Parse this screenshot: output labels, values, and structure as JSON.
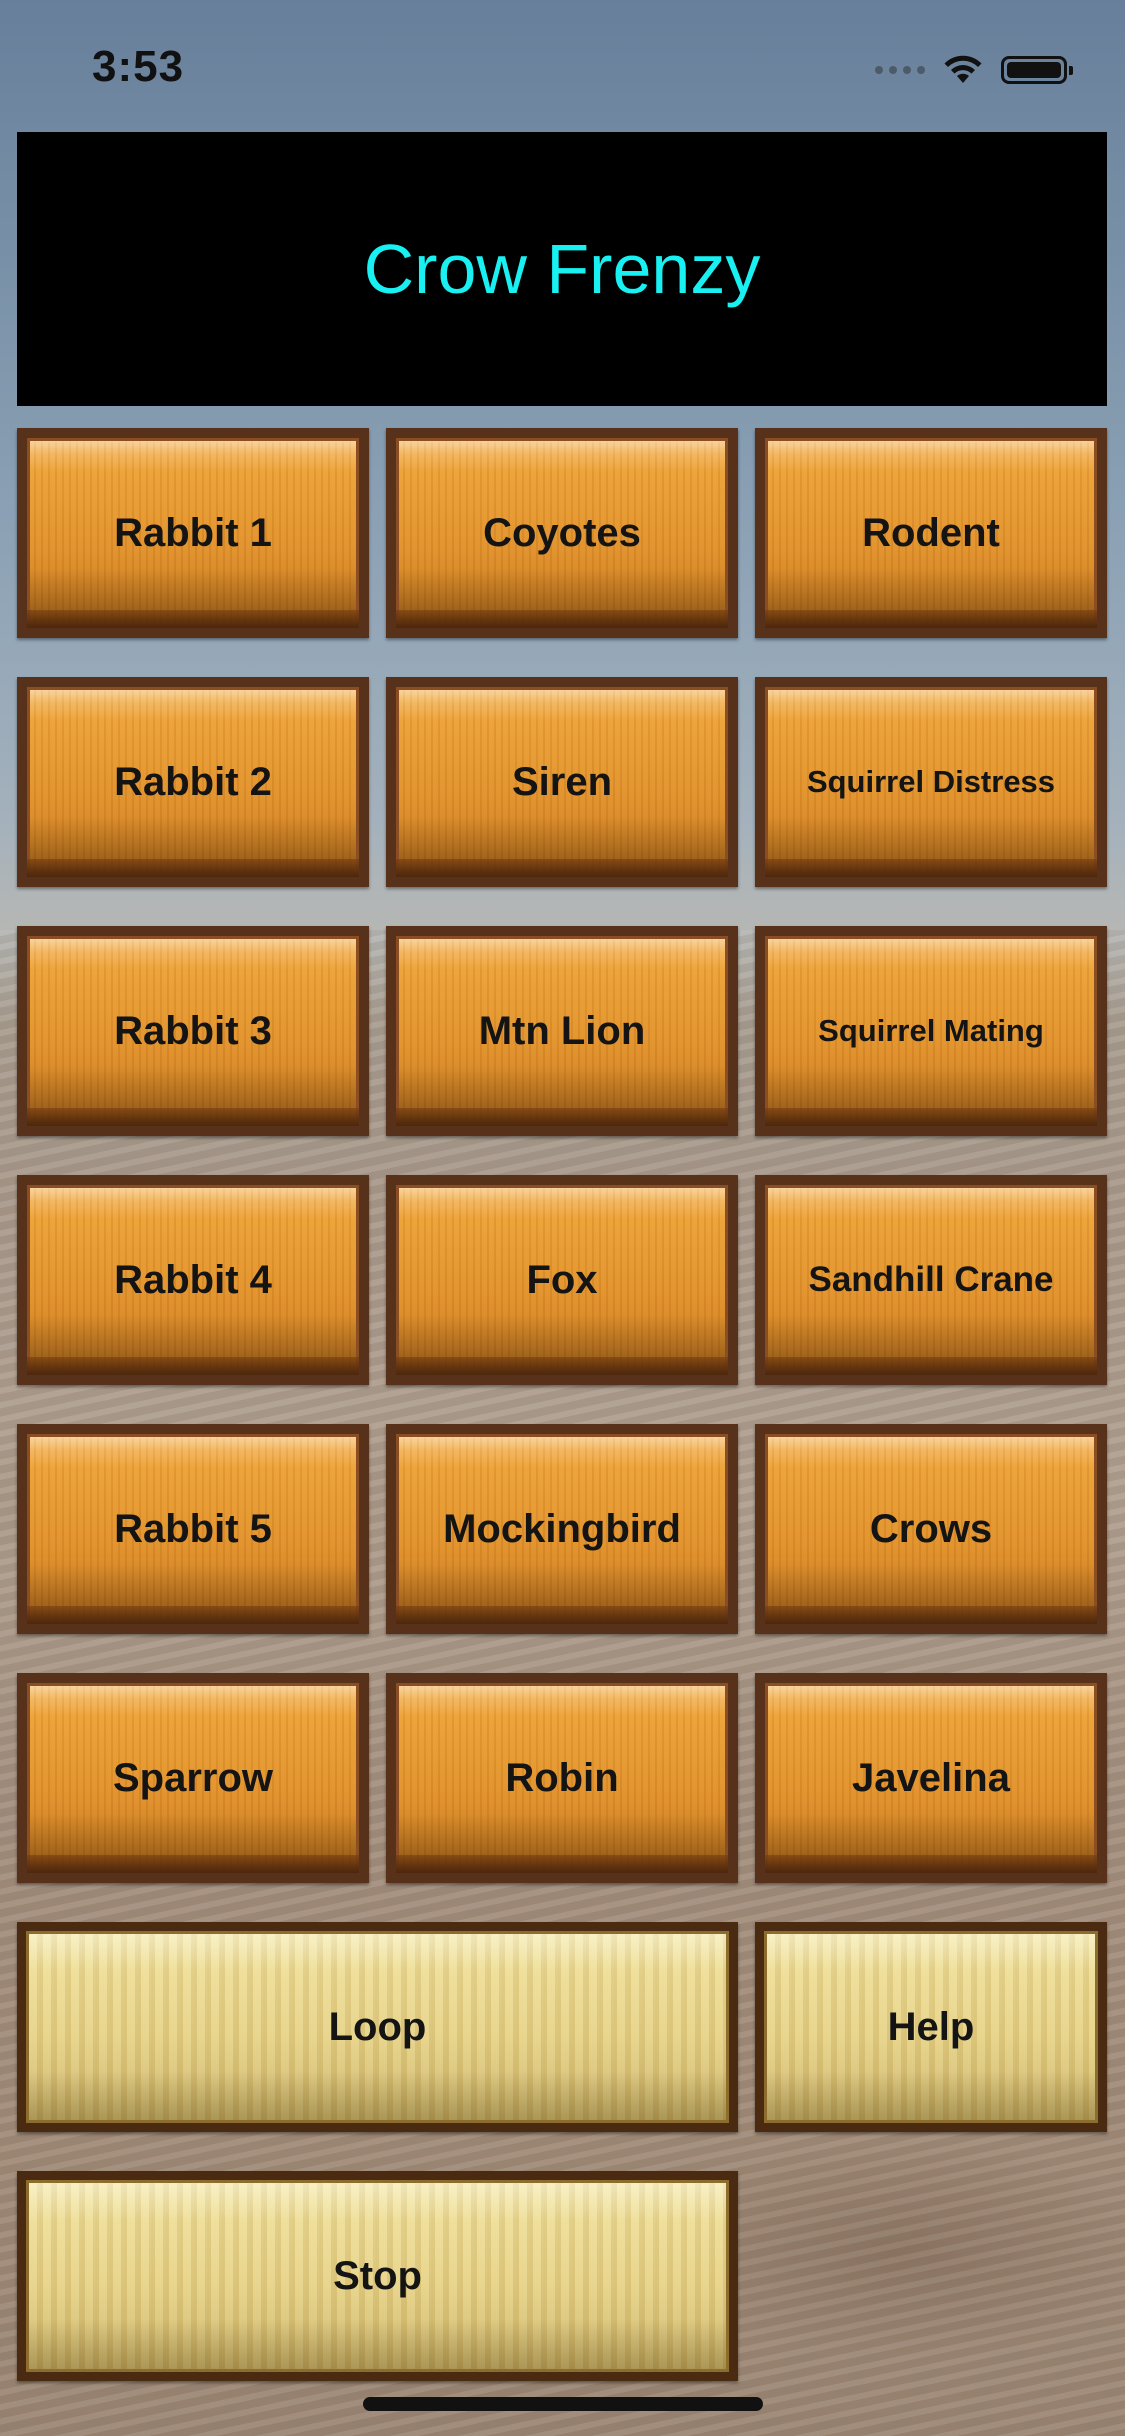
{
  "status_bar": {
    "time": "3:53",
    "icons": [
      "cellular-icon",
      "wifi-icon",
      "battery-icon"
    ]
  },
  "app": {
    "title": "Crow Frenzy",
    "title_color": "#19f0f2"
  },
  "sound_buttons": [
    {
      "label": "Rabbit 1"
    },
    {
      "label": "Coyotes"
    },
    {
      "label": "Rodent"
    },
    {
      "label": "Rabbit 2"
    },
    {
      "label": "Siren"
    },
    {
      "label": "Squirrel Distress"
    },
    {
      "label": "Rabbit 3"
    },
    {
      "label": "Mtn Lion"
    },
    {
      "label": "Squirrel Mating"
    },
    {
      "label": "Rabbit 4"
    },
    {
      "label": "Fox"
    },
    {
      "label": "Sandhill Crane"
    },
    {
      "label": "Rabbit 5"
    },
    {
      "label": "Mockingbird"
    },
    {
      "label": "Crows"
    },
    {
      "label": "Sparrow"
    },
    {
      "label": "Robin"
    },
    {
      "label": "Javelina"
    }
  ],
  "controls": {
    "loop": "Loop",
    "help": "Help",
    "stop": "Stop"
  },
  "colors": {
    "wood_button": "#e1922c",
    "wood_border": "#57311a",
    "pale_button": "#e6d187",
    "banner_background": "#000000"
  }
}
